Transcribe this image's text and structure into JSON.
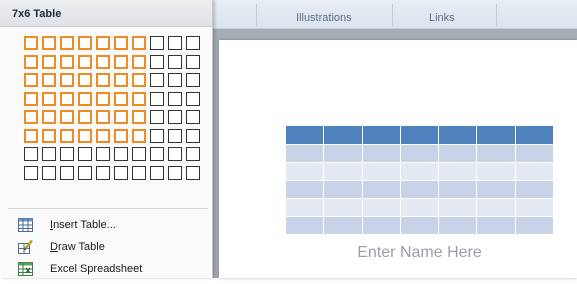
{
  "ribbon": {
    "groups": [
      "Illustrations",
      "Links"
    ]
  },
  "panel": {
    "title": "7x6 Table",
    "grid": {
      "columns": 10,
      "rows": 8,
      "selected_columns": 7,
      "selected_rows": 6
    },
    "menu_items": [
      {
        "label_first": "I",
        "label_rest": "nsert Table...",
        "icon": "insert-table-icon"
      },
      {
        "label_first": "D",
        "label_rest": "raw Table",
        "icon": "draw-table-icon"
      },
      {
        "label_first": "",
        "label_rest": "Excel Spreadsheet",
        "icon": "excel-spreadsheet-icon"
      }
    ]
  },
  "document": {
    "placeholder": "Enter Name Here"
  },
  "colors": {
    "highlight_border": "#f08a24",
    "table_header": "#4f81bd",
    "table_band": "#c9d3e8"
  }
}
